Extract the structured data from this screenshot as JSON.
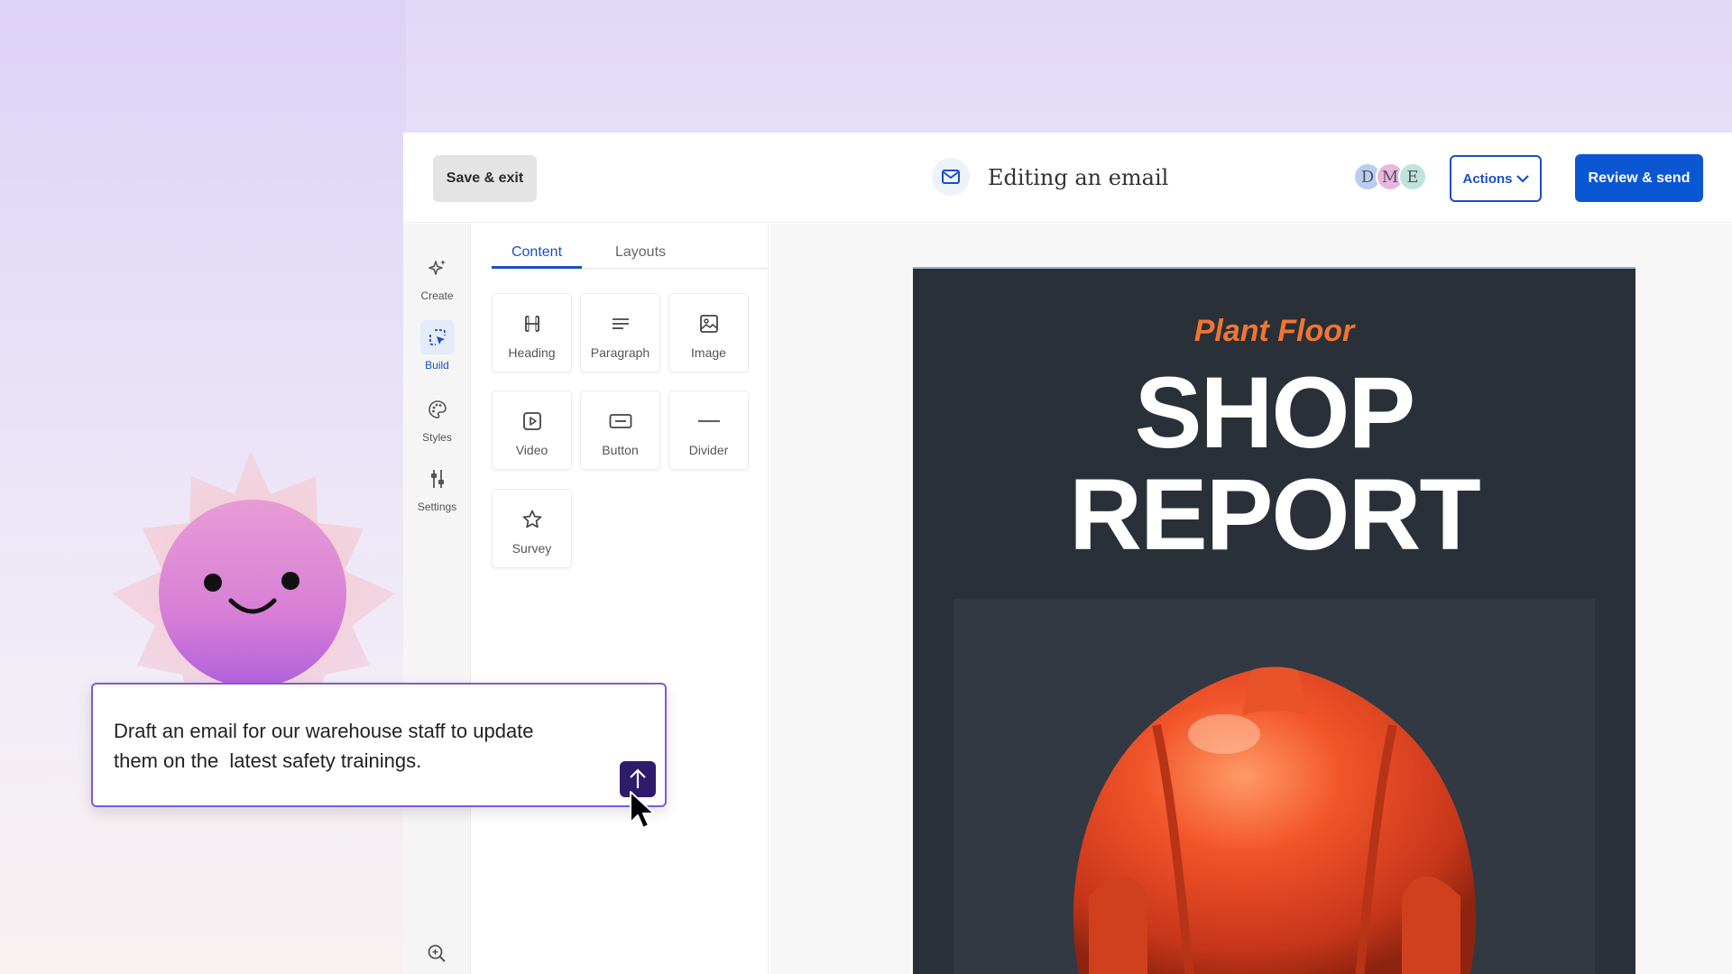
{
  "topbar": {
    "save_exit_label": "Save & exit",
    "title": "Editing an email",
    "avatars": [
      {
        "initial": "D",
        "color": "#b9cdf1"
      },
      {
        "initial": "M",
        "color": "#e8b7df"
      },
      {
        "initial": "E",
        "color": "#bfe3dd"
      }
    ],
    "actions_label": "Actions",
    "review_send_label": "Review & send"
  },
  "rail": {
    "items": [
      {
        "label": "Create",
        "icon": "sparkle-icon"
      },
      {
        "label": "Build",
        "icon": "build-cursor-icon",
        "active": true
      },
      {
        "label": "Styles",
        "icon": "palette-icon"
      },
      {
        "label": "Settings",
        "icon": "sliders-icon"
      }
    ],
    "zoom_icon": "zoom-in-icon"
  },
  "panel": {
    "tabs": [
      {
        "label": "Content",
        "active": true
      },
      {
        "label": "Layouts"
      }
    ],
    "blocks": [
      {
        "label": "Heading",
        "icon": "heading-icon"
      },
      {
        "label": "Paragraph",
        "icon": "paragraph-icon"
      },
      {
        "label": "Image",
        "icon": "image-icon"
      },
      {
        "label": "Video",
        "icon": "video-icon"
      },
      {
        "label": "Button",
        "icon": "button-icon"
      },
      {
        "label": "Divider",
        "icon": "divider-icon"
      },
      {
        "label": "Survey",
        "icon": "star-icon"
      }
    ]
  },
  "email": {
    "kicker": "Plant Floor",
    "headline_line1": "SHOP",
    "headline_line2": "REPORT",
    "kicker_color": "#f07632",
    "background_color": "#2a3038"
  },
  "prompt": {
    "text": "Draft an email for our warehouse staff to update\nthem on the  latest safety trainings.",
    "send_icon": "arrow-up-icon"
  },
  "colors": {
    "accent": "#0b56d3",
    "prompt_border": "#7d5bd6",
    "send_button": "#2e1b6b"
  }
}
